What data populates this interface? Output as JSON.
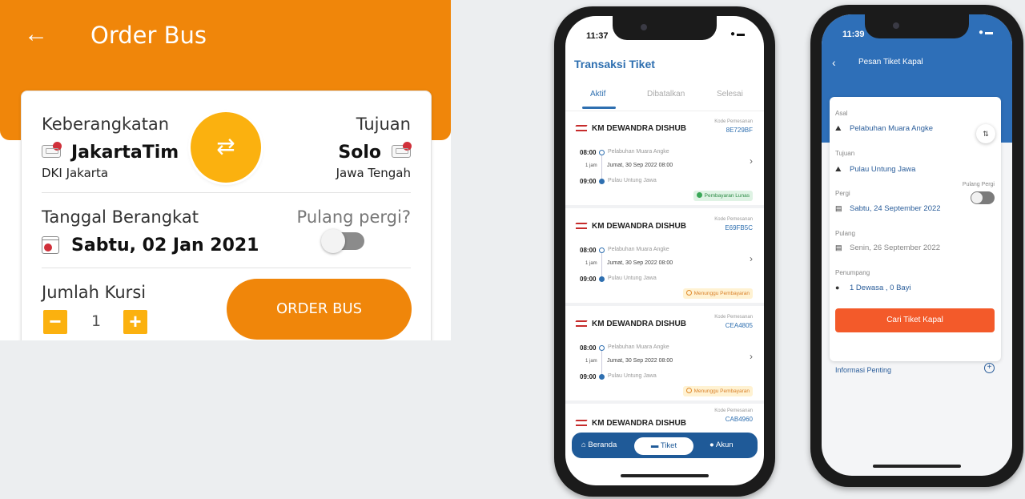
{
  "order_bus": {
    "back_icon": "arrow-left-icon",
    "title": "Order Bus",
    "origin_label": "Keberangkatan",
    "origin_city": "JakartaTim",
    "origin_region": "DKI Jakarta",
    "destination_label": "Tujuan",
    "destination_city": "Solo",
    "destination_region": "Jawa Tengah",
    "swap_icon": "swap-arrows-icon",
    "date_label": "Tanggal Berangkat",
    "date_value": "Sabtu, 02 Jan 2021",
    "round_trip_label": "Pulang pergi?",
    "round_trip_on": false,
    "seats_label": "Jumlah Kursi",
    "seats_minus": "−",
    "seats_value": "1",
    "seats_plus": "+",
    "order_button": "ORDER BUS",
    "accent_color": "#f0860a",
    "secondary_color": "#fbb10f"
  },
  "phone_transaksi": {
    "status_time": "11:37",
    "title": "Transaksi Tiket",
    "tabs": [
      "Aktif",
      "Dibatalkan",
      "Selesai"
    ],
    "active_tab": "Aktif",
    "tickets": [
      {
        "ship": "KM DEWANDRA DISHUB",
        "kode_label": "Kode Pemesanan",
        "kode": "8E729BF",
        "dep_time": "08:00",
        "dep_port": "Pelabuhan Muara Angke",
        "duration": "1 jam",
        "date": "Jumat, 30 Sep 2022 08:00",
        "arr_time": "09:00",
        "arr_port": "Pulau Untung Jawa",
        "status": "Pembayaran Lunas",
        "status_type": "paid"
      },
      {
        "ship": "KM DEWANDRA DISHUB",
        "kode_label": "Kode Pemesanan",
        "kode": "E69FB5C",
        "dep_time": "08:00",
        "dep_port": "Pelabuhan Muara Angke",
        "duration": "1 jam",
        "date": "Jumat, 30 Sep 2022 08:00",
        "arr_time": "09:00",
        "arr_port": "Pulau Untung Jawa",
        "status": "Menunggu Pembayaran",
        "status_type": "waiting"
      },
      {
        "ship": "KM DEWANDRA DISHUB",
        "kode_label": "Kode Pemesanan",
        "kode": "CEA4805",
        "dep_time": "08:00",
        "dep_port": "Pelabuhan Muara Angke",
        "duration": "1 jam",
        "date": "Jumat, 30 Sep 2022 08:00",
        "arr_time": "09:00",
        "arr_port": "Pulau Untung Jawa",
        "status": "Menunggu Pembayaran",
        "status_type": "waiting"
      },
      {
        "ship": "KM DEWANDRA DISHUB",
        "kode_label": "Kode Pemesanan",
        "kode": "CAB4960"
      }
    ],
    "nav": [
      "Beranda",
      "Tiket",
      "Akun"
    ],
    "nav_active": "Tiket",
    "brand_color": "#2e6fb0"
  },
  "phone_pesan": {
    "status_time": "11:39",
    "title": "Pesan Tiket Kapal",
    "asal_label": "Asal",
    "asal_value": "Pelabuhan Muara Angke",
    "tujuan_label": "Tujuan",
    "tujuan_value": "Pulau Untung Jawa",
    "pergi_label": "Pergi",
    "pergi_value": "Sabtu, 24 September 2022",
    "pulang_pergi_label": "Pulang Pergi",
    "pulang_label": "Pulang",
    "pulang_value": "Senin, 26 September 2022",
    "penumpang_label": "Penumpang",
    "penumpang_value": "1 Dewasa , 0 Bayi",
    "search_button": "Cari Tiket Kapal",
    "info_label": "Informasi Penting",
    "button_color": "#f35a2a"
  }
}
